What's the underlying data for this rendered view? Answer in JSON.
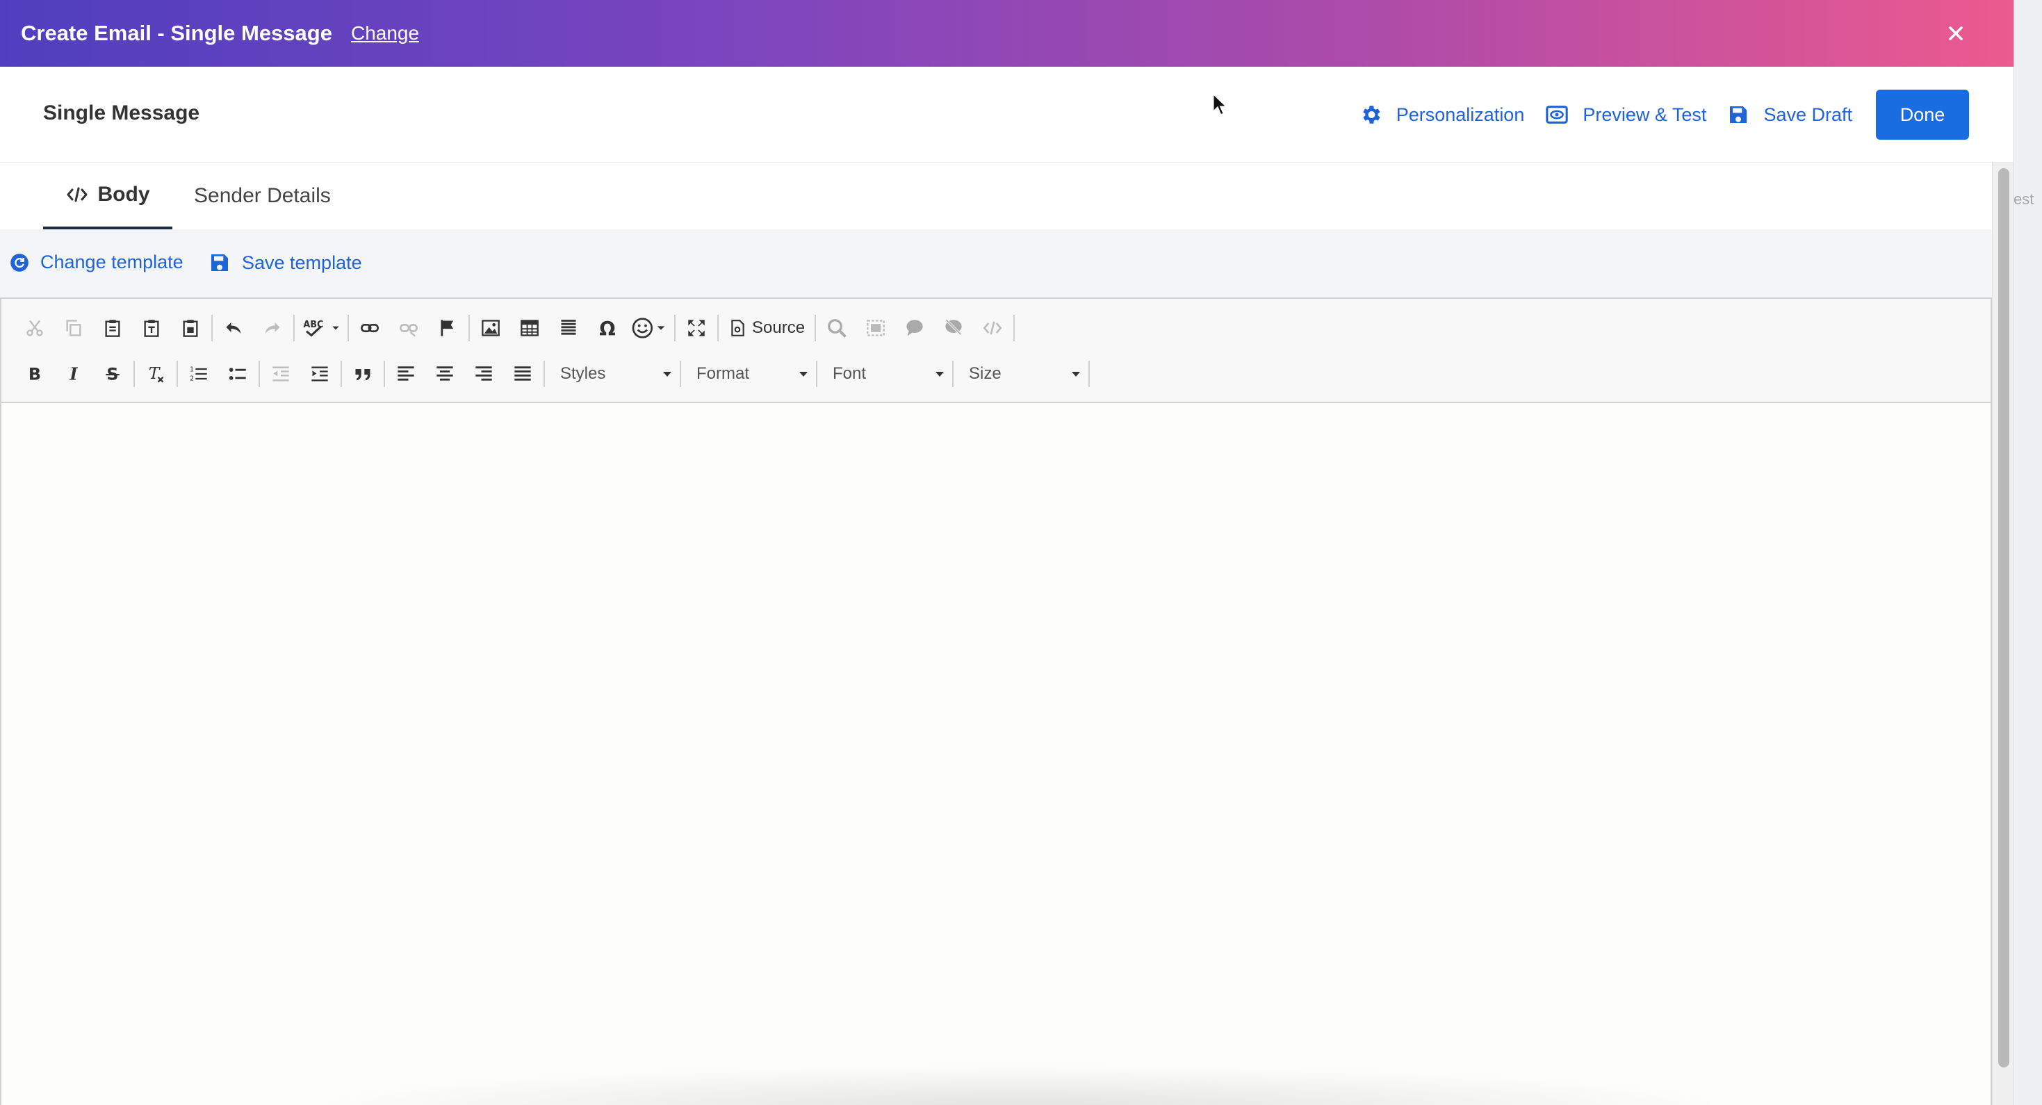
{
  "titlebar": {
    "title": "Create Email - Single Message",
    "change_link": "Change"
  },
  "backdrop": {
    "edge_text": "est"
  },
  "header": {
    "heading": "Single Message",
    "personalization": "Personalization",
    "preview_test": "Preview & Test",
    "save_draft": "Save Draft",
    "done": "Done"
  },
  "tabs": {
    "body": "Body",
    "sender_details": "Sender Details"
  },
  "template_bar": {
    "change_template": "Change template",
    "save_template": "Save template"
  },
  "toolbar": {
    "source": "Source",
    "styles": "Styles",
    "format": "Format",
    "font": "Font",
    "size": "Size"
  },
  "colors": {
    "link": "#1f63d8",
    "primary": "#1a6de0",
    "gradient_start": "#4f3fbe",
    "gradient_end": "#ec5a8e"
  }
}
